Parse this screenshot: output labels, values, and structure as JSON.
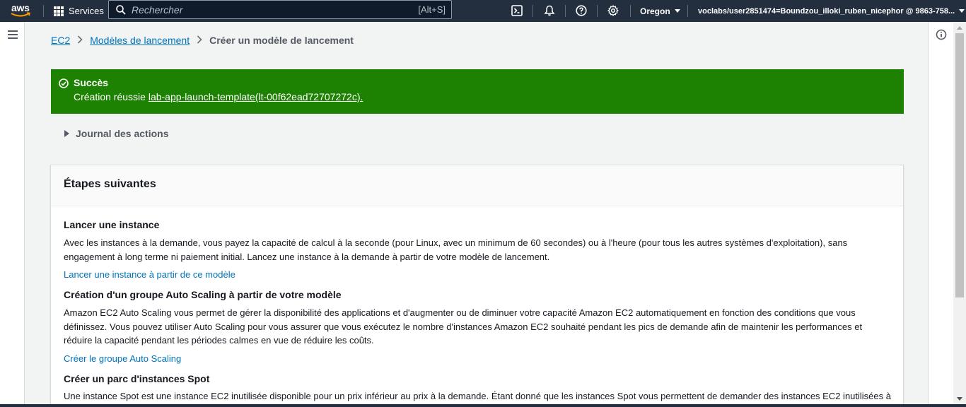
{
  "topnav": {
    "logo_text": "aws",
    "services_label": "Services",
    "search_placeholder": "Rechercher",
    "search_shortcut": "[Alt+S]",
    "icons": [
      "cloudshell-icon",
      "bell-icon",
      "help-icon",
      "gear-icon"
    ],
    "region_label": "Oregon",
    "account_label": "voclabs/user2851474=Boundzou_illoki_ruben_nicephor @ 9863-758..."
  },
  "breadcrumb": {
    "items": [
      "EC2",
      "Modèles de lancement"
    ],
    "current": "Créer un modèle de lancement"
  },
  "flash": {
    "title": "Succès",
    "message_prefix": "Création réussie ",
    "message_link": "lab-app-launch-template(lt-00f62ead72707272c).",
    "color": "#1d8102"
  },
  "journal": {
    "label": "Journal des actions"
  },
  "panel": {
    "title": "Étapes suivantes",
    "sections": [
      {
        "title": "Lancer une instance",
        "text": "Avec les instances à la demande, vous payez la capacité de calcul à la seconde (pour Linux, avec un minimum de 60 secondes) ou à l'heure (pour tous les autres systèmes d'exploitation), sans engagement à long terme ni paiement initial. Lancez une instance à la demande à partir de votre modèle de lancement.",
        "link": "Lancer une instance à partir de ce modèle"
      },
      {
        "title": "Création d'un groupe Auto Scaling à partir de votre modèle",
        "text": "Amazon EC2 Auto Scaling vous permet de gérer la disponibilité des applications et d'augmenter ou de diminuer votre capacité Amazon EC2 automatiquement en fonction des conditions que vous définissez. Vous pouvez utiliser Auto Scaling pour vous assurer que vous exécutez le nombre d'instances Amazon EC2 souhaité pendant les pics de demande afin de maintenir les performances et réduire la capacité pendant les périodes calmes en vue de réduire les coûts.",
        "link": "Créer le groupe Auto Scaling"
      },
      {
        "title": "Créer un parc d'instances Spot",
        "text": "Une instance Spot est une instance EC2 inutilisée disponible pour un prix inférieur au prix à la demande. Étant donné que les instances Spot vous permettent de demander des instances EC2 inutilisées à des"
      }
    ]
  },
  "colors": {
    "nav_bg": "#232f3e",
    "link": "#0073bb",
    "success": "#1d8102"
  }
}
